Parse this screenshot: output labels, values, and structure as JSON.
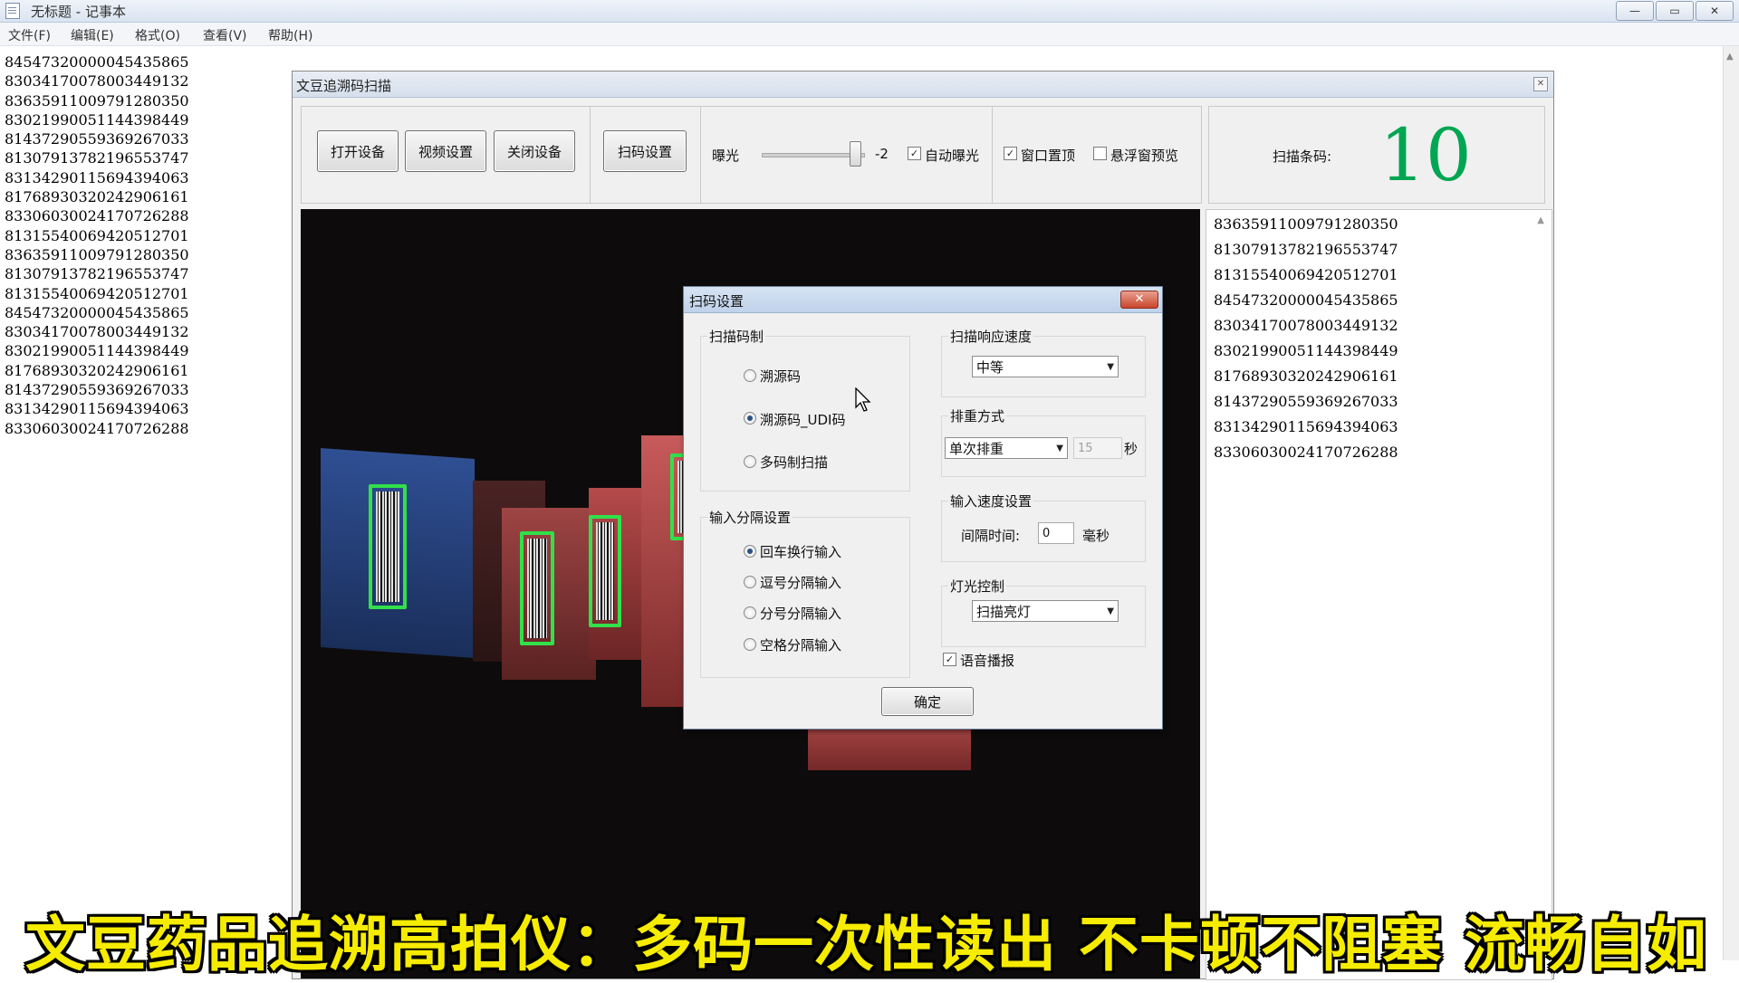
{
  "notepad": {
    "title": "无标题 - 记事本",
    "window_buttons": [
      "—",
      "▭",
      "✕"
    ],
    "menu": [
      "文件(F)",
      "编辑(E)",
      "格式(O)",
      "查看(V)",
      "帮助(H)"
    ],
    "lines": [
      "84547320000045435865",
      "83034170078003449132",
      "83635911009791280350",
      "83021990051144398449",
      "81437290559369267033",
      "81307913782196553747",
      "83134290115694394063",
      "81768930320242906161",
      "83306030024170726288",
      "81315540069420512701",
      "83635911009791280350",
      "81307913782196553747",
      "81315540069420512701",
      "84547320000045435865",
      "83034170078003449132",
      "83021990051144398449",
      "81768930320242906161",
      "81437290559369267033",
      "83134290115694394063",
      "83306030024170726288"
    ]
  },
  "scanner": {
    "title": "文豆追溯码扫描",
    "close_glyph": "✕",
    "buttons": {
      "open": "打开设备",
      "video": "视频设置",
      "close": "关闭设备",
      "scan_settings": "扫码设置"
    },
    "exposure_label": "曝光",
    "exposure_value": "-2",
    "auto_exposure_label": "自动曝光",
    "auto_exposure_checked": true,
    "window_topmost_label": "窗口置顶",
    "window_topmost_checked": true,
    "floating_preview_label": "悬浮窗预览",
    "floating_preview_checked": false,
    "scan_count_label": "扫描条码:",
    "scan_count": "10",
    "results": [
      "83635911009791280350",
      "81307913782196553747",
      "81315540069420512701",
      "84547320000045435865",
      "83034170078003449132",
      "83021990051144398449",
      "81768930320242906161",
      "81437290559369267033",
      "83134290115694394063",
      "83306030024170726288"
    ]
  },
  "dialog": {
    "title": "扫码设置",
    "close_glyph": "✕",
    "symbology": {
      "title": "扫描码制",
      "options": [
        "溯源码",
        "溯源码_UDI码",
        "多码制扫描"
      ],
      "selected": 1
    },
    "separator": {
      "title": "输入分隔设置",
      "options": [
        "回车换行输入",
        "逗号分隔输入",
        "分号分隔输入",
        "空格分隔输入"
      ],
      "selected": 0
    },
    "response_speed": {
      "title": "扫描响应速度",
      "value": "中等"
    },
    "dedup": {
      "title": "排重方式",
      "value": "单次排重",
      "seconds": "15",
      "unit": "秒"
    },
    "input_speed": {
      "title": "输入速度设置",
      "interval_label": "间隔时间:",
      "interval_value": "0",
      "unit": "毫秒"
    },
    "light": {
      "title": "灯光控制",
      "value": "扫描亮灯"
    },
    "voice_label": "语音播报",
    "voice_checked": true,
    "ok_label": "确定"
  },
  "caption": "文豆药品追溯高拍仪：多码一次性读出 不卡顿不阻塞 流畅自如"
}
